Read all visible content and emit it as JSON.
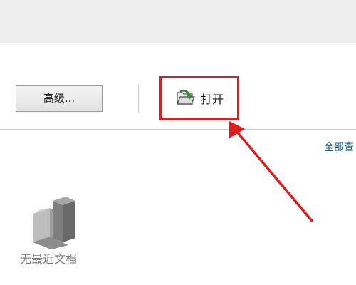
{
  "toolbar": {
    "advanced_label": "高级...",
    "open_label": "打开"
  },
  "links": {
    "view_all": "全部查"
  },
  "empty_state": {
    "message": "无最近文档",
    "icon": "blocks-icon"
  },
  "icons": {
    "open": "folder-open-icon"
  },
  "colors": {
    "highlight": "#e01c1c",
    "link": "#1a5e8c",
    "muted_text": "#7a7a7a"
  }
}
